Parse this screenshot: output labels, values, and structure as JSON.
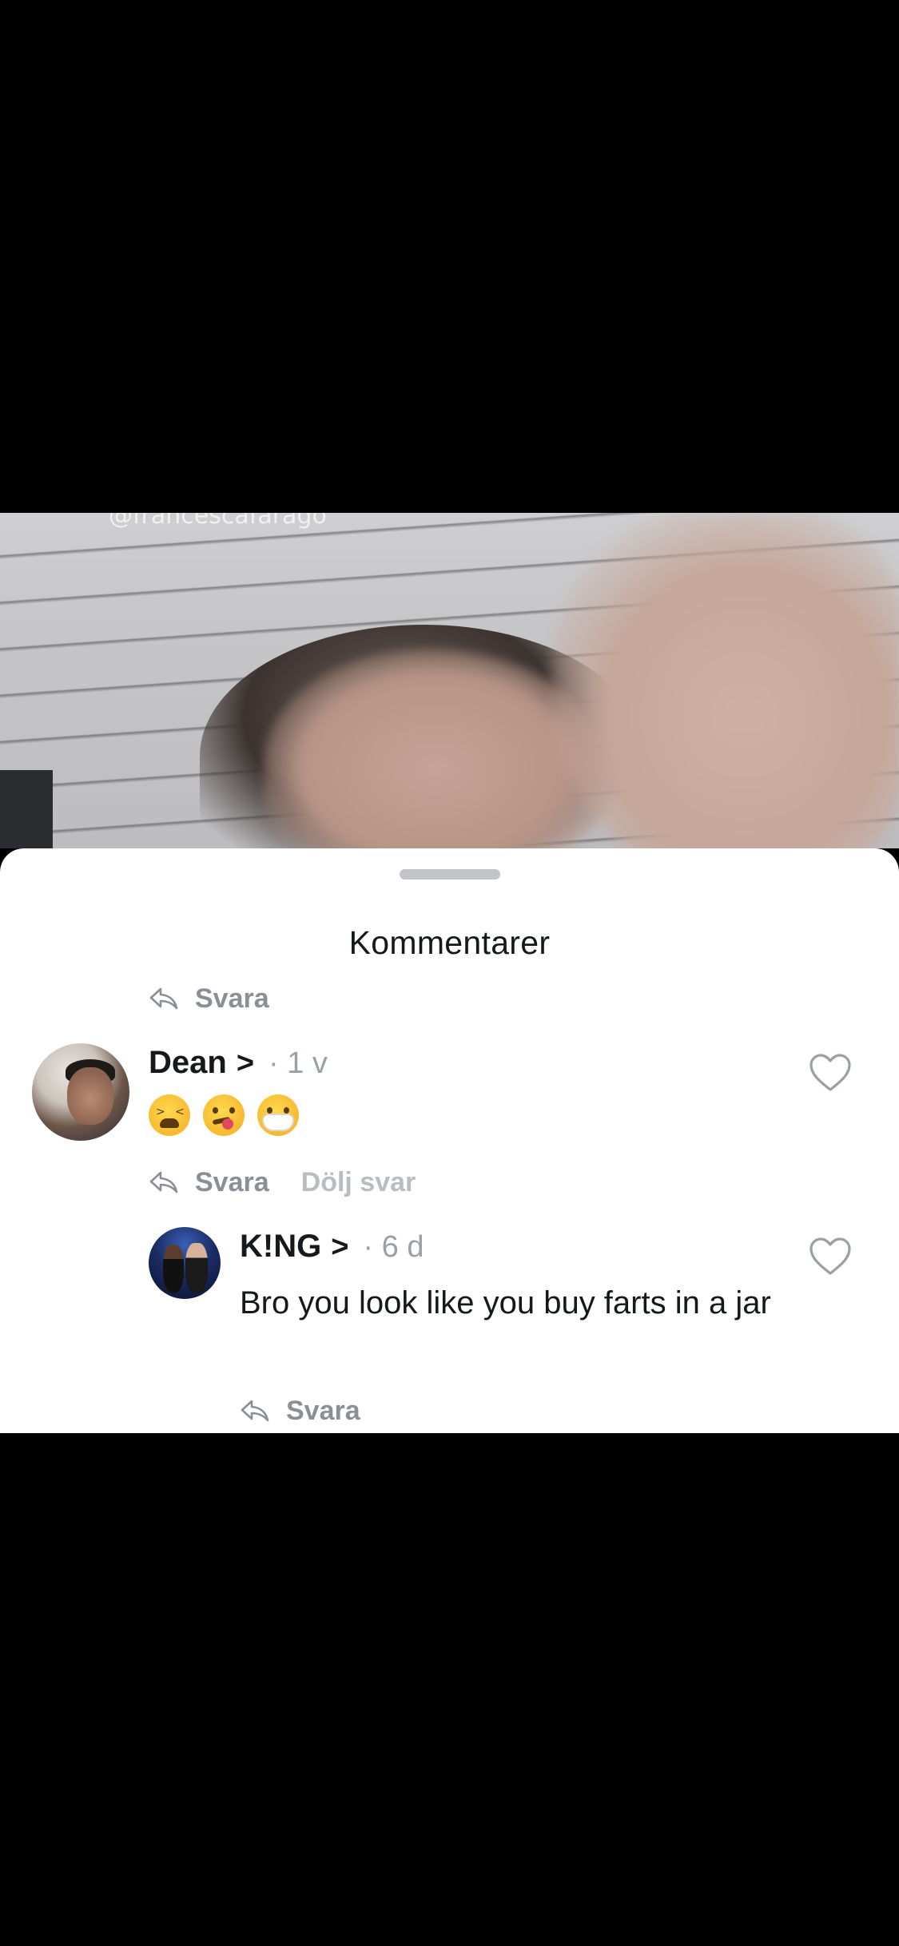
{
  "video": {
    "watermark": "@francescafarago"
  },
  "comments_sheet": {
    "title": "Kommentarer",
    "reply_label": "Svara",
    "hide_replies_label": "Dölj svar"
  },
  "comments": [
    {
      "username": "Dean",
      "chevron": ">",
      "meta": "· 1 v",
      "emojis": [
        "tired-face",
        "face-with-tongue",
        "face-with-medical-mask"
      ],
      "avatar": "avatar-dean"
    },
    {
      "username": "K!NG",
      "chevron": ">",
      "meta": "· 6 d",
      "text": "Bro you look like you buy farts in a jar",
      "avatar": "avatar-king"
    }
  ],
  "icons": {
    "reply": "reply-arrow-icon",
    "like": "heart-outline-icon"
  },
  "colors": {
    "sheet_bg": "#ffffff",
    "text_primary": "#16191c",
    "text_secondary": "#8a8f96",
    "text_muted": "#b9bdc2",
    "backdrop": "#000000"
  }
}
